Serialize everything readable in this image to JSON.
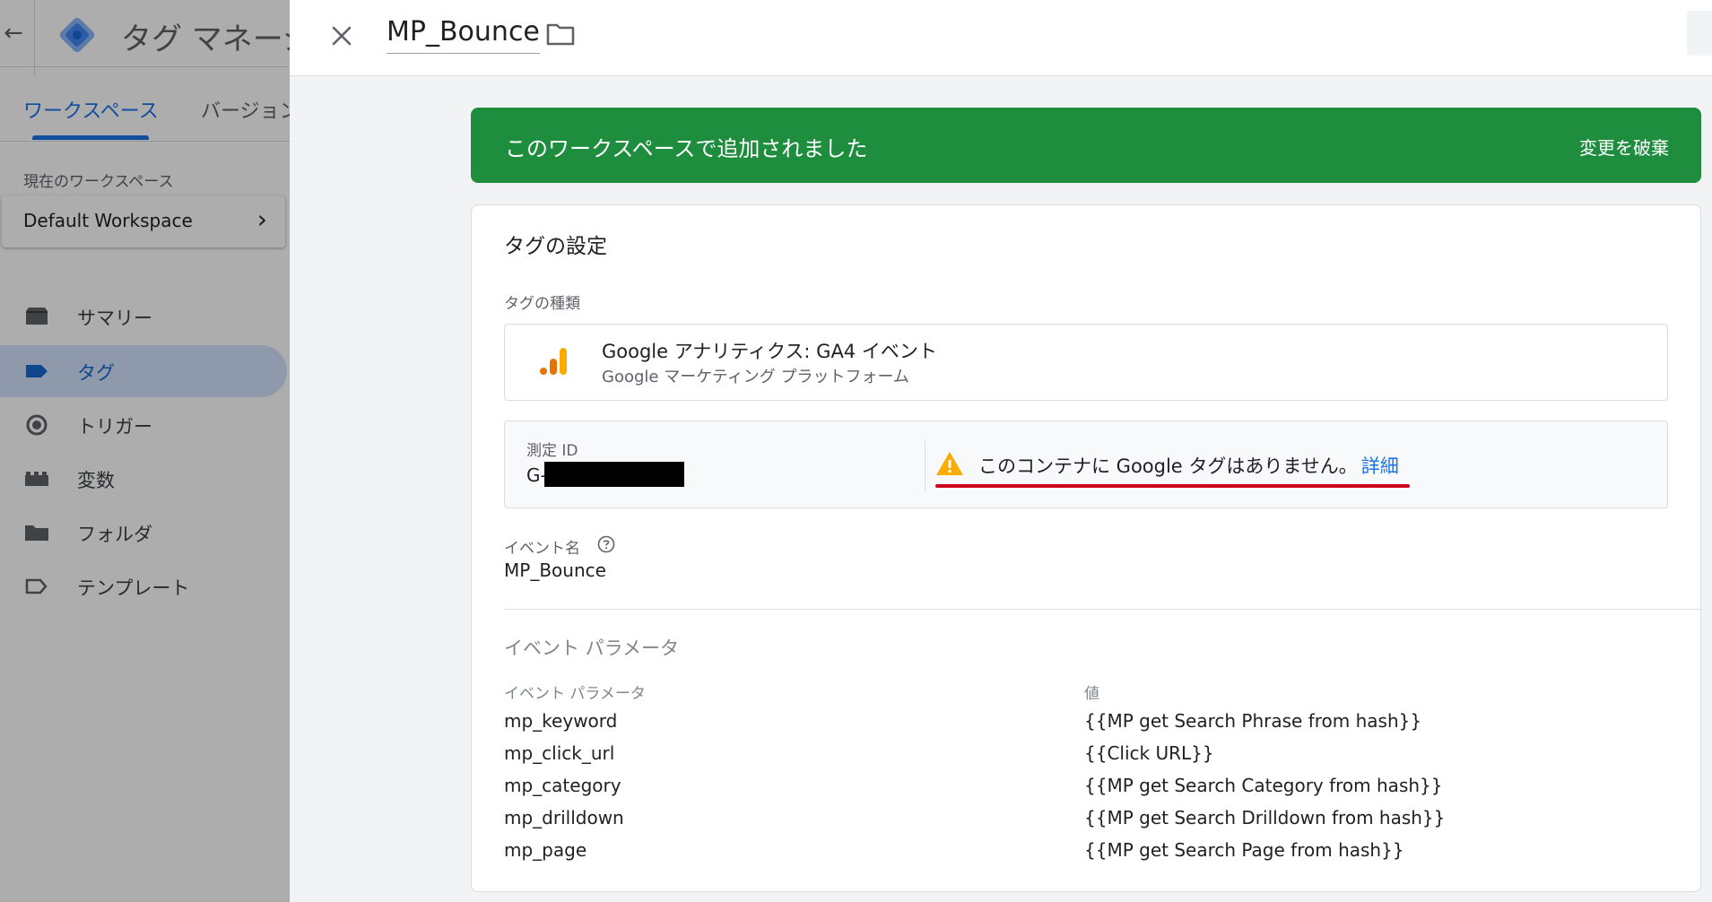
{
  "app": {
    "title": "タグ マネージャー",
    "tabs": [
      {
        "label": "ワークスペース",
        "active": true
      },
      {
        "label": "バージョン",
        "active": false
      }
    ],
    "workspace_label": "現在のワークスペース",
    "workspace_name": "Default Workspace",
    "nav": [
      {
        "label": "サマリー",
        "icon": "summary-icon",
        "active": false
      },
      {
        "label": "タグ",
        "icon": "tag-icon",
        "active": true
      },
      {
        "label": "トリガー",
        "icon": "trigger-icon",
        "active": false
      },
      {
        "label": "変数",
        "icon": "variables-icon",
        "active": false
      },
      {
        "label": "フォルダ",
        "icon": "folder-icon",
        "active": false
      },
      {
        "label": "テンプレート",
        "icon": "template-icon",
        "active": false
      }
    ]
  },
  "panel": {
    "title": "MP_Bounce",
    "banner": {
      "text": "このワークスペースで追加されました",
      "action": "変更を破棄",
      "color": "#1e8e3e"
    },
    "card": {
      "title": "タグの設定",
      "type_label": "タグの種類",
      "type_name": "Google アナリティクス: GA4 イベント",
      "type_vendor": "Google マーケティング プラットフォーム",
      "measurement_label": "測定 ID",
      "measurement_value": "G-",
      "warning_text": "このコンテナに Google タグはありません。",
      "warning_link": "詳細",
      "event_name_label": "イベント名",
      "event_name": "MP_Bounce",
      "params_section": "イベント パラメータ",
      "col_param": "イベント パラメータ",
      "col_value": "値",
      "params": [
        {
          "name": "mp_keyword",
          "value": "{{MP get Search Phrase from hash}}"
        },
        {
          "name": "mp_click_url",
          "value": "{{Click URL}}"
        },
        {
          "name": "mp_category",
          "value": "{{MP get Search Category from hash}}"
        },
        {
          "name": "mp_drilldown",
          "value": "{{MP get Search Drilldown from hash}}"
        },
        {
          "name": "mp_page",
          "value": "{{MP get Search Page from hash}}"
        }
      ]
    }
  }
}
